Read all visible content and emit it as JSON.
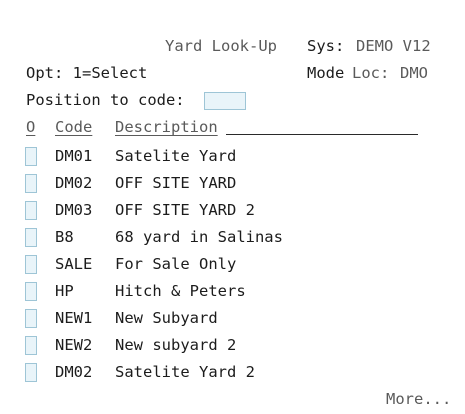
{
  "header": {
    "title": "Yard Look-Up",
    "sys_label": "Sys:",
    "sys_value": "DEMO V12",
    "opt_text": "Opt: 1=Select",
    "mode_label": "Mode",
    "loc_label": "Loc:",
    "loc_value": "DMO",
    "position_label": "Position to code:",
    "position_value": ""
  },
  "columns": {
    "option": "O",
    "code": "Code",
    "description": "Description"
  },
  "rows": [
    {
      "option": "",
      "code": "DM01",
      "description": "Satelite Yard"
    },
    {
      "option": "",
      "code": "DM02",
      "description": "OFF SITE YARD"
    },
    {
      "option": "",
      "code": "DM03",
      "description": "OFF SITE YARD 2"
    },
    {
      "option": "",
      "code": "B8",
      "description": "68 yard in Salinas"
    },
    {
      "option": "",
      "code": "SALE",
      "description": "For Sale Only"
    },
    {
      "option": "",
      "code": "HP",
      "description": "Hitch & Peters"
    },
    {
      "option": "",
      "code": "NEW1",
      "description": "New Subyard"
    },
    {
      "option": "",
      "code": "NEW2",
      "description": "New subyard 2"
    },
    {
      "option": "",
      "code": "DM02",
      "description": "Satelite Yard 2"
    }
  ],
  "footer": {
    "more": "More..."
  }
}
